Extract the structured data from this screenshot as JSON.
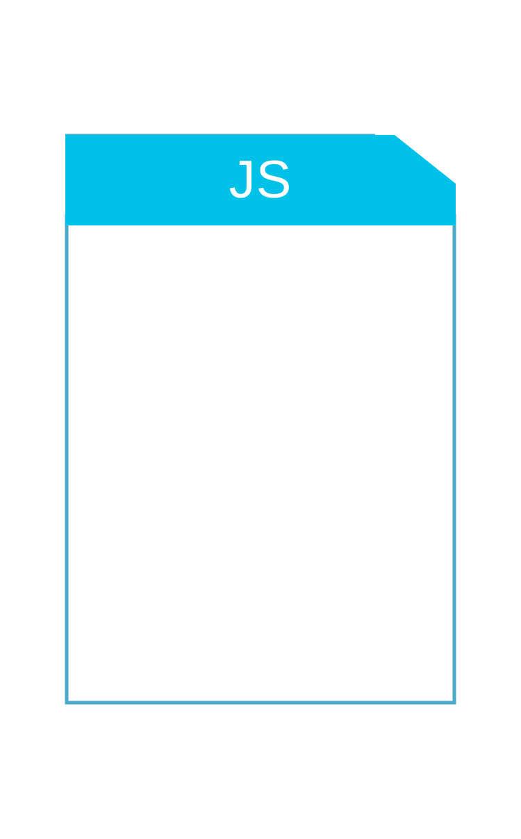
{
  "icon": {
    "name": "javascript-file-icon",
    "label": "JS",
    "colors": {
      "header": "#00c2e8",
      "border": "#4aabc9",
      "body": "#ffffff",
      "label_text": "#ffffff"
    }
  }
}
